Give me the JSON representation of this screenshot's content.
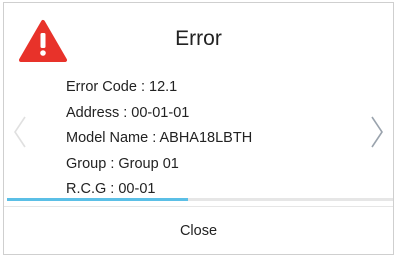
{
  "dialog": {
    "title": "Error",
    "icon": "warning-triangle-icon",
    "details": [
      "Error Code : 12.1",
      "Address : 00-01-01",
      "Model Name : ABHA18LBTH",
      "Group  : Group 01",
      "R.C.G  : 00-01"
    ],
    "progress_fraction": 0.47,
    "close_label": "Close"
  },
  "colors": {
    "warning_red": "#e8322a",
    "progress_blue": "#5bbfe6",
    "arrow_gray": "#9aa3ad",
    "prev_arrow_gray": "#e0e0e0"
  }
}
